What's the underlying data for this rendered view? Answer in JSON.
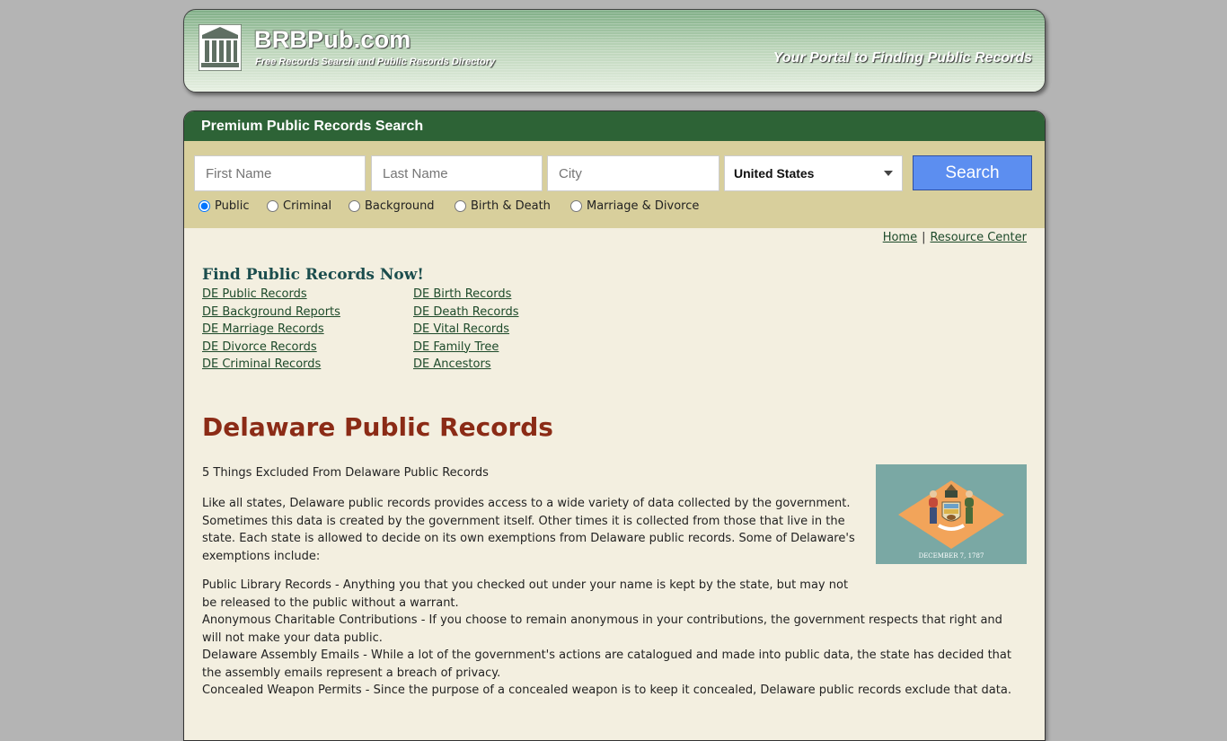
{
  "header": {
    "site_title": "BRBPub.com",
    "tagline": "Free Records Search and Public Records Directory",
    "slogan": "Your Portal to Finding Public Records"
  },
  "search": {
    "panel_title": "Premium Public Records Search",
    "first_name_placeholder": "First Name",
    "last_name_placeholder": "Last Name",
    "city_placeholder": "City",
    "country_selected": "United States",
    "button_label": "Search",
    "record_types": [
      {
        "label": "Public",
        "checked": true
      },
      {
        "label": "Criminal",
        "checked": false
      },
      {
        "label": "Background",
        "checked": false
      },
      {
        "label": "Birth & Death",
        "checked": false
      },
      {
        "label": "Marriage & Divorce",
        "checked": false
      }
    ]
  },
  "nav": {
    "home": "Home",
    "separator": "|",
    "resource_center": "Resource Center"
  },
  "find": {
    "heading": "Find Public Records Now!",
    "col1": [
      "DE Public Records",
      "DE Background Reports",
      "DE Marriage Records",
      "DE Divorce Records",
      "DE Criminal Records"
    ],
    "col2": [
      "DE Birth Records",
      "DE Death Records",
      "DE Vital Records",
      "DE Family Tree",
      "DE Ancestors"
    ]
  },
  "article": {
    "title": "Delaware Public Records",
    "subhead": "5 Things Excluded From Delaware Public Records",
    "intro": "Like all states, Delaware public records provides access to a wide variety of data collected by the government. Sometimes this data is created by the government itself. Other times it is collected from those that live in the state. Each state is allowed to decide on its own exemptions from Delaware public records. Some of Delaware's exemptions include:",
    "item1": "Public Library Records - Anything you that you checked out under your name is kept by the state, but may not be released to the public without a warrant.",
    "item2": "Anonymous Charitable Contributions - If you choose to remain anonymous in your contributions, the government respects that right and will not make your data public.",
    "item3": "Delaware Assembly Emails - While a lot of the government's actions are catalogued and made into public data, the state has decided that the assembly emails represent a breach of privacy.",
    "item4": "Concealed Weapon Permits - Since the purpose of a concealed weapon is to keep it concealed, Delaware public records exclude that data."
  },
  "flag": {
    "date_text": "DECEMBER 7, 1787",
    "field_color": "#7aa8a4",
    "diamond_color": "#f2a45a"
  }
}
